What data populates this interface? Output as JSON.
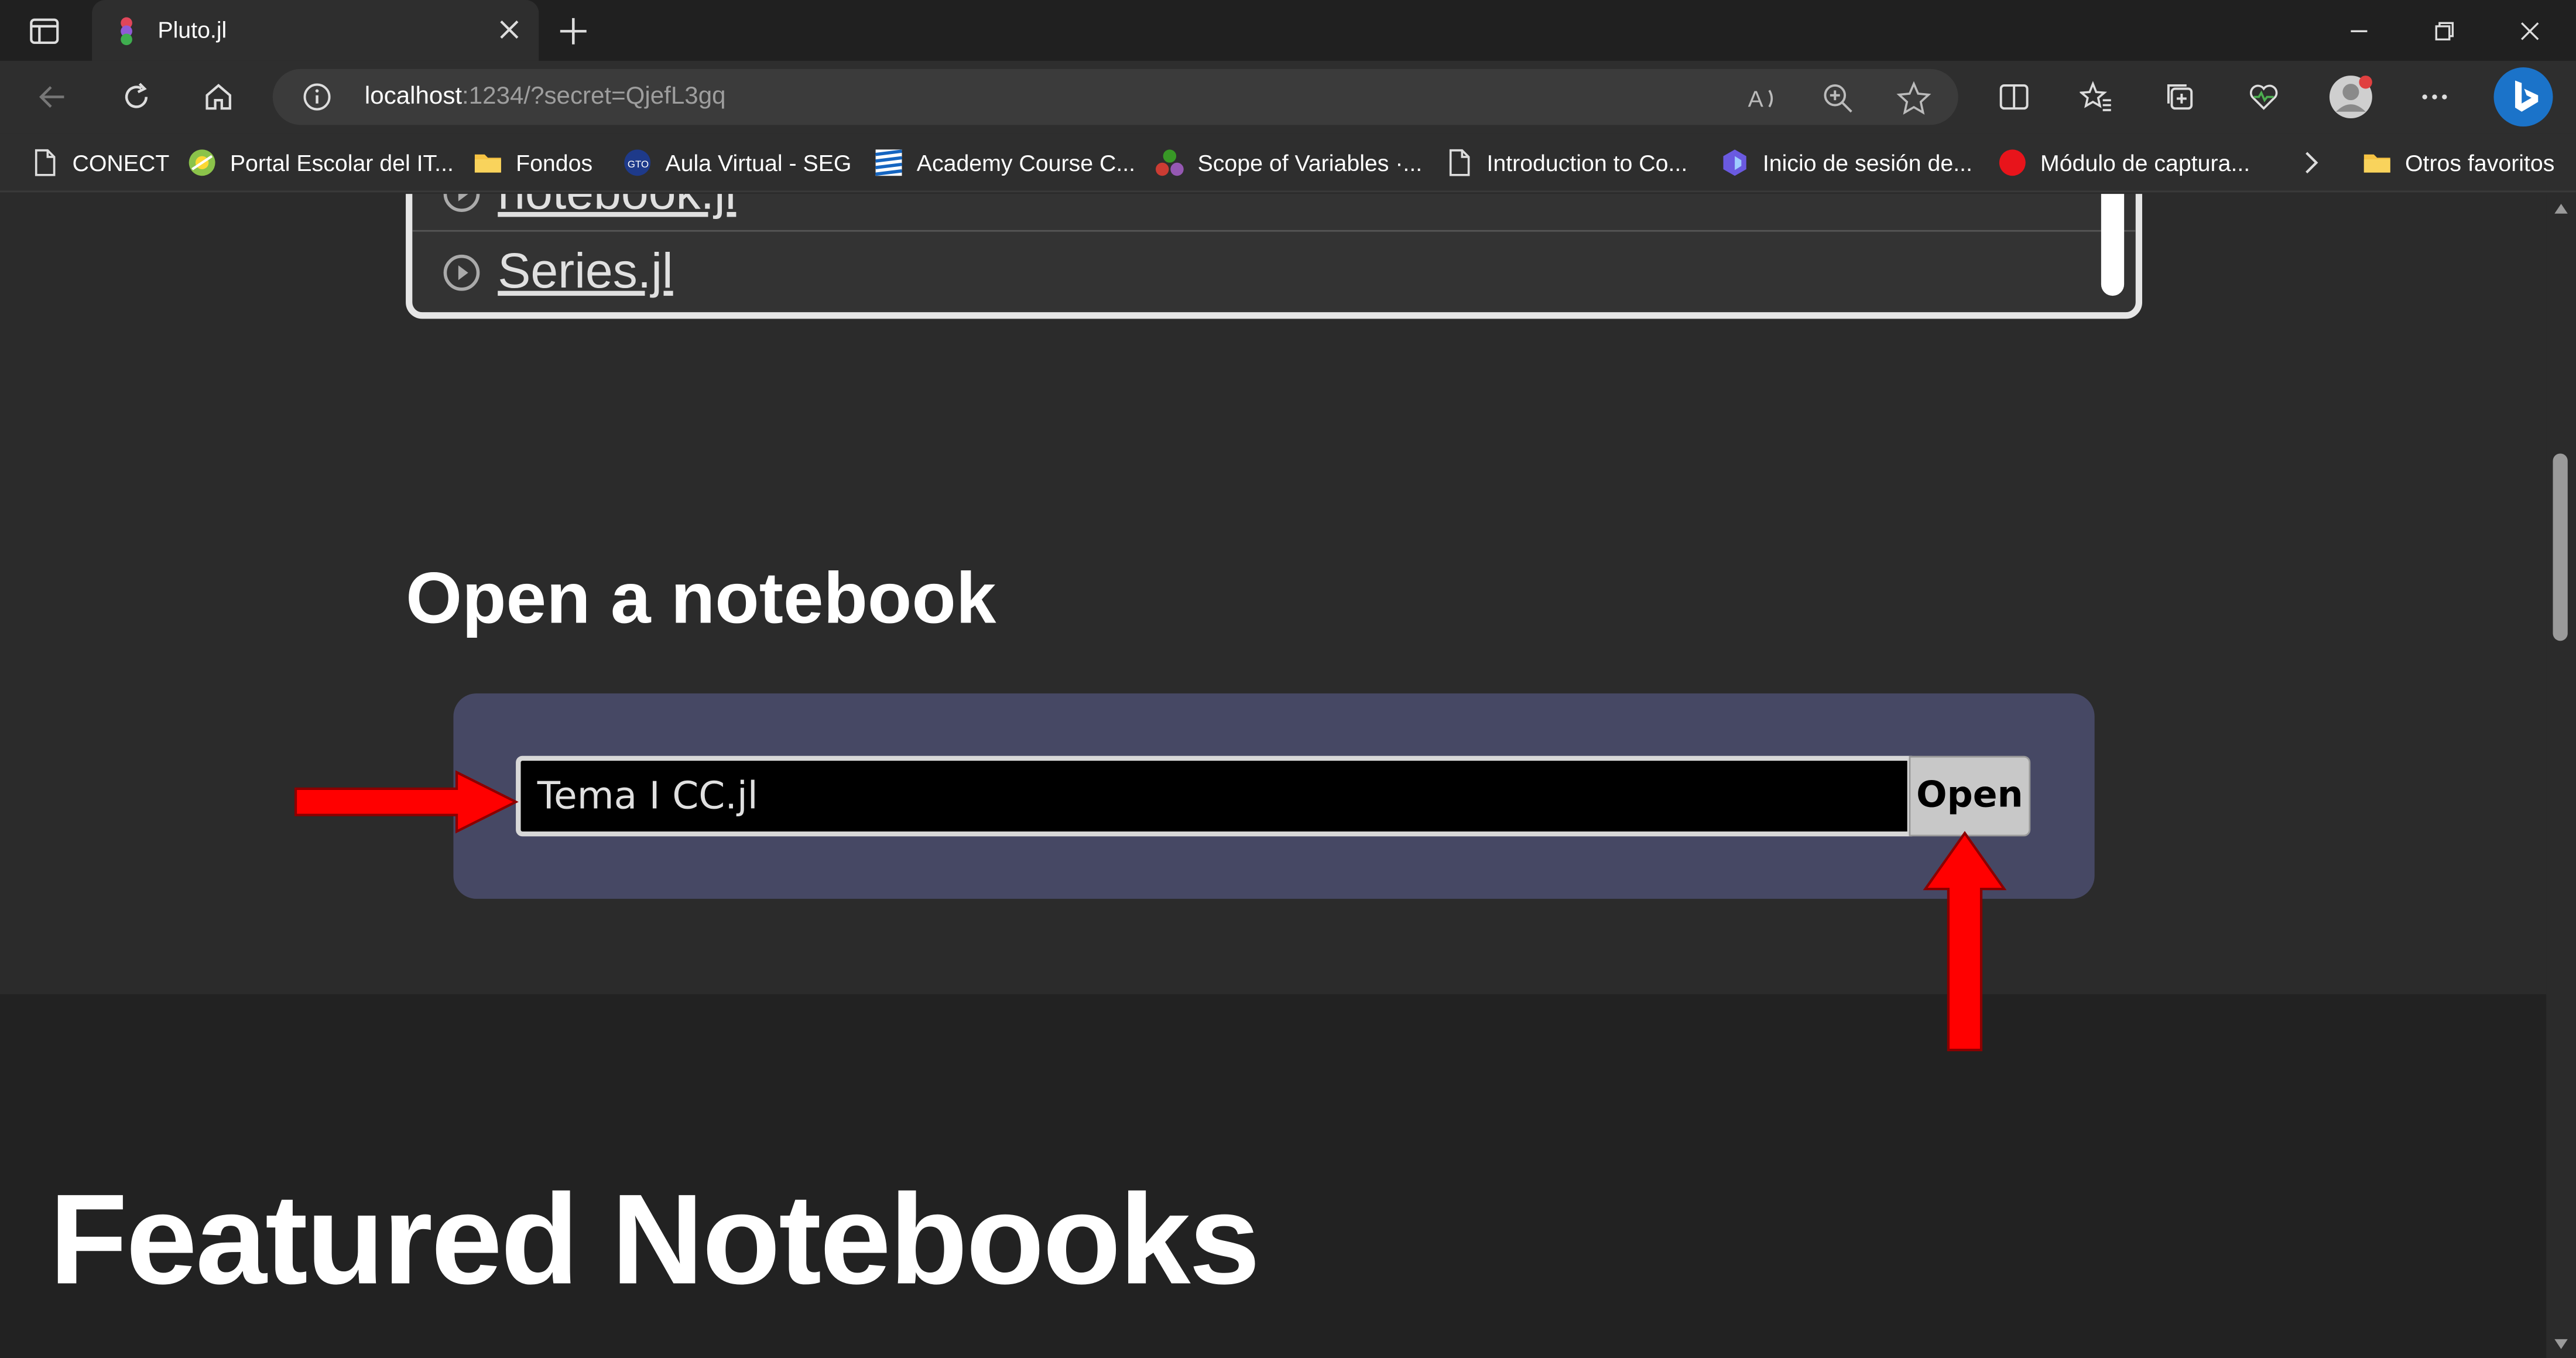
{
  "browser": {
    "tab_title": "Pluto.jl",
    "url_host": "localhost",
    "url_rest": ":1234/?secret=QjefL3gq",
    "icons": {
      "sidebar": "sidebar-toggle-icon",
      "favicon": "pluto-favicon-icon",
      "close_tab": "close-icon",
      "new_tab": "plus-icon",
      "back": "back-arrow-icon",
      "refresh": "refresh-icon",
      "home": "home-icon",
      "site_info": "info-icon",
      "read_aloud": "read-aloud-icon",
      "zoom": "zoom-icon",
      "favorite": "star-icon",
      "split_screen": "split-screen-icon",
      "favorites": "favorites-icon",
      "collections": "collections-icon",
      "performance": "heartbeat-icon",
      "profile": "avatar-icon",
      "more": "more-icon",
      "copilot": "bing-icon"
    }
  },
  "favorites": [
    {
      "label": "CONECT",
      "icon": "page-icon"
    },
    {
      "label": "Portal Escolar del IT...",
      "icon": "itsc-logo-icon"
    },
    {
      "label": "Fondos",
      "icon": "folder-icon"
    },
    {
      "label": "Aula Virtual - SEG",
      "icon": "seg-logo-icon"
    },
    {
      "label": "Academy Course C...",
      "icon": "stripes-icon"
    },
    {
      "label": "Scope of Variables ·...",
      "icon": "julia-dots-icon"
    },
    {
      "label": "Introduction to Co...",
      "icon": "page-icon"
    },
    {
      "label": "Inicio de sesión de...",
      "icon": "teams-icon"
    },
    {
      "label": "Módulo de captura...",
      "icon": "red-dot-icon"
    },
    {
      "label": "Otros favoritos",
      "icon": "folder-icon"
    }
  ],
  "recent": {
    "items": [
      {
        "label": "notebook.jl"
      },
      {
        "label": "Series.jl"
      }
    ]
  },
  "open_section": {
    "title": "Open a notebook",
    "input_value": "Tema I CC.jl",
    "button_label": "Open"
  },
  "featured": {
    "title": "Featured Notebooks"
  },
  "colors": {
    "panel": "#464864",
    "annotation_arrow": "#ff0000",
    "background": "#2b2b2b"
  }
}
